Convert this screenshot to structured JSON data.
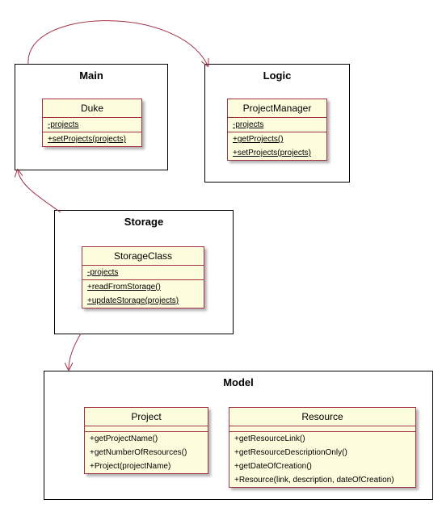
{
  "packages": {
    "main": {
      "title": "Main"
    },
    "logic": {
      "title": "Logic"
    },
    "storage": {
      "title": "Storage"
    },
    "model": {
      "title": "Model"
    }
  },
  "classes": {
    "duke": {
      "name": "Duke",
      "attrs": [
        "-projects"
      ],
      "methods": [
        "+setProjects(projects)"
      ]
    },
    "projectManager": {
      "name": "ProjectManager",
      "attrs": [
        "-projects"
      ],
      "methods": [
        "+getProjects()",
        "+setProjects(projects)"
      ]
    },
    "storageClass": {
      "name": "StorageClass",
      "attrs": [
        "-projects"
      ],
      "methods": [
        "+readFromStorage()",
        "+updateStorage(projects)"
      ]
    },
    "project": {
      "name": "Project",
      "attrs": [],
      "methods": [
        "+getProjectName()",
        "+getNumberOfResources()",
        "+Project(projectName)"
      ]
    },
    "resource": {
      "name": "Resource",
      "attrs": [],
      "methods": [
        "+getResourceLink()",
        "+getResourceDescriptionOnly()",
        "+getDateOfCreation()",
        "+Resource(link, description, dateOfCreation)"
      ]
    }
  }
}
